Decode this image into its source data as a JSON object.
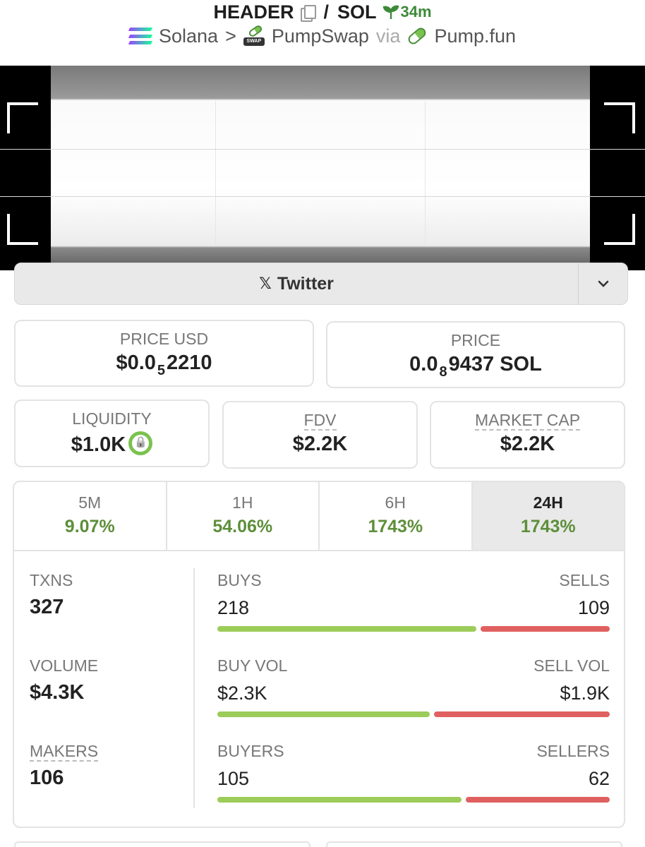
{
  "header": {
    "name": "HEADER",
    "slash": "/",
    "quote": "SOL",
    "age": "34m",
    "chain": "Solana",
    "sep": ">",
    "dex": "PumpSwap",
    "via": "via",
    "launchpad": "Pump.fun"
  },
  "social": {
    "twitter_label": "Twitter",
    "x_glyph": "𝕏",
    "chevron": "⌄"
  },
  "price_usd": {
    "label": "PRICE USD",
    "prefix": "$0.0",
    "zeros": "5",
    "digits": "2210"
  },
  "price_native": {
    "label": "PRICE",
    "prefix": "0.0",
    "zeros": "8",
    "digits": "9437 SOL"
  },
  "liquidity": {
    "label": "LIQUIDITY",
    "value": "$1.0K"
  },
  "fdv": {
    "label": "FDV",
    "value": "$2.2K"
  },
  "market_cap": {
    "label": "MARKET CAP",
    "value": "$2.2K"
  },
  "tabs": [
    {
      "label": "5M",
      "value": "9.07%"
    },
    {
      "label": "1H",
      "value": "54.06%"
    },
    {
      "label": "6H",
      "value": "1743%"
    },
    {
      "label": "24H",
      "value": "1743%"
    }
  ],
  "stats": {
    "txns": {
      "label": "TXNS",
      "value": "327"
    },
    "volume": {
      "label": "VOLUME",
      "value": "$4.3K"
    },
    "makers": {
      "label": "MAKERS",
      "value": "106"
    },
    "buys": {
      "label": "BUYS",
      "value": "218",
      "sell_label": "SELLS",
      "sell_value": "109",
      "buy_share": 0.667
    },
    "vol": {
      "label": "BUY VOL",
      "value": "$2.3K",
      "sell_label": "SELL VOL",
      "sell_value": "$1.9K",
      "buy_share": 0.548
    },
    "buyers": {
      "label": "BUYERS",
      "value": "105",
      "sell_label": "SELLERS",
      "sell_value": "62",
      "buy_share": 0.629
    }
  },
  "colors": {
    "positive": "#5d8f3a",
    "buy_bar": "#9ccc5a",
    "sell_bar": "#e06060"
  }
}
